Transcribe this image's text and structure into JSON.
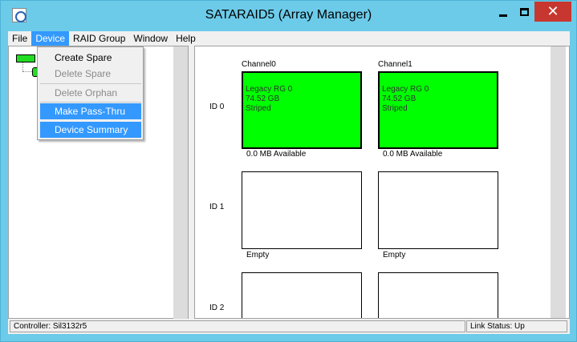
{
  "window": {
    "title": "SATARAID5 (Array Manager)",
    "close_glyph": "✕"
  },
  "menubar": {
    "items": [
      {
        "label": "File"
      },
      {
        "label": "Device"
      },
      {
        "label": "RAID Group"
      },
      {
        "label": "Window"
      },
      {
        "label": "Help"
      }
    ],
    "active": "Device"
  },
  "device_menu": {
    "items": [
      {
        "label": "Create Spare",
        "enabled": true
      },
      {
        "label": "Delete Spare",
        "enabled": false
      },
      {
        "label": "Delete Orphan",
        "enabled": false
      },
      {
        "label": "Make Pass-Thru",
        "enabled": true,
        "highlighted": true
      },
      {
        "label": "Device Summary",
        "enabled": true,
        "highlighted": true
      }
    ]
  },
  "grid": {
    "channels": [
      "Channel0",
      "Channel1"
    ],
    "rows": [
      {
        "label": "ID 0",
        "slots": [
          {
            "lines": [
              "Legacy RG 0",
              "74.52 GB",
              "Striped"
            ],
            "caption": "0.0 MB Available",
            "status": "used"
          },
          {
            "lines": [
              "Legacy RG 0",
              "74.52 GB",
              "Striped"
            ],
            "caption": "0.0 MB Available",
            "status": "used"
          }
        ]
      },
      {
        "label": "ID 1",
        "slots": [
          {
            "lines": [],
            "caption": "Empty",
            "status": "empty"
          },
          {
            "lines": [],
            "caption": "Empty",
            "status": "empty"
          }
        ]
      },
      {
        "label": "ID 2",
        "slots": [
          {
            "lines": [],
            "caption": "",
            "status": "empty"
          },
          {
            "lines": [],
            "caption": "",
            "status": "empty"
          }
        ]
      }
    ]
  },
  "statusbar": {
    "controller": "Controller: Sil3132r5",
    "link": "Link Status: Up"
  },
  "colors": {
    "titlebar": "#6ccbe9",
    "close_button": "#c7372f",
    "menu_highlight": "#3399ff",
    "drive_used": "#00ff00"
  },
  "icons": {
    "app": "array-manager-icon",
    "minimize": "minimize-icon",
    "maximize": "maximize-icon",
    "close": "close-icon",
    "tree_root": "controller-icon",
    "tree_child": "drive-icon"
  }
}
